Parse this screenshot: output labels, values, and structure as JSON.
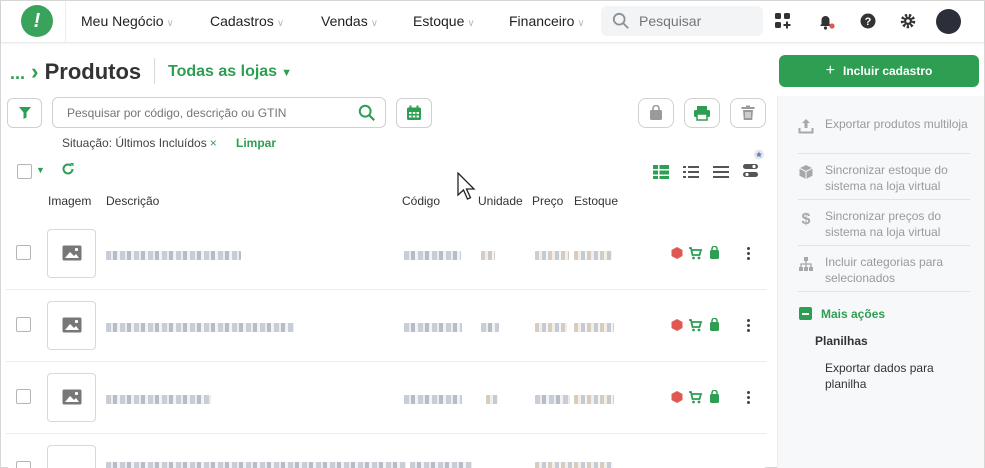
{
  "topbar": {
    "nav": [
      {
        "label": "Meu Negócio"
      },
      {
        "label": "Cadastros"
      },
      {
        "label": "Vendas"
      },
      {
        "label": "Estoque"
      },
      {
        "label": "Financeiro"
      }
    ],
    "search_placeholder": "Pesquisar",
    "icons": [
      "apps-icon",
      "bell-icon",
      "help-icon",
      "gear-icon"
    ]
  },
  "header": {
    "breadcrumb_dots": "...",
    "title": "Produtos",
    "store_filter": "Todas as lojas"
  },
  "toolbar": {
    "search_placeholder": "Pesquisar por código, descrição ou GTIN"
  },
  "filters": {
    "situacao_label": "Situação: Últimos Incluídos",
    "remove_symbol": "×",
    "clear_label": "Limpar"
  },
  "table": {
    "columns": [
      "Imagem",
      "Descrição",
      "Código",
      "Unidade",
      "Preço",
      "Estoque"
    ]
  },
  "sidebar": {
    "add_button": "Incluir cadastro",
    "actions": [
      {
        "label": "Exportar produtos multiloja",
        "icon": "upload-icon"
      },
      {
        "label": "Sincronizar estoque do sistema na loja virtual",
        "icon": "box-icon"
      },
      {
        "label": "Sincronizar preços do sistema na loja virtual",
        "icon": "dollar-icon"
      },
      {
        "label": "Incluir categorias para selecionados",
        "icon": "hierarchy-icon"
      }
    ],
    "more_actions": "Mais ações",
    "section_title": "Planilhas",
    "export_data": "Exportar dados para planilha"
  },
  "colors": {
    "accent": "#2e9e52",
    "logo": "#3aa35b",
    "red_status": "#e0584f"
  }
}
